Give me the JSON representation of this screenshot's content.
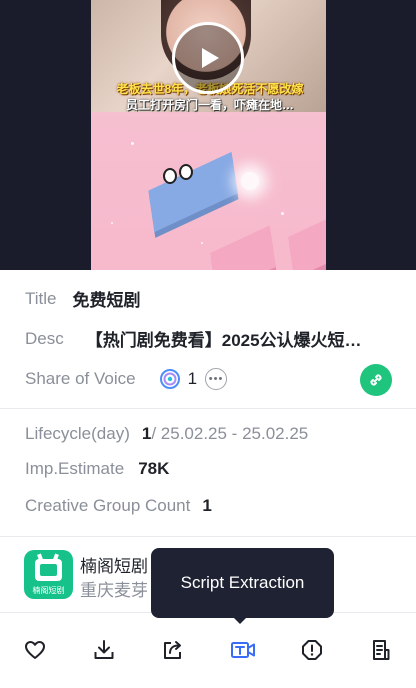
{
  "video": {
    "caption_line1": "老板去世8年，老板娘死活不愿改嫁",
    "caption_line2": "员工打开房门一看，吓瘫在地…",
    "play_icon": "play-icon"
  },
  "info": {
    "title_label": "Title",
    "title_value": "免费短剧",
    "desc_label": "Desc",
    "desc_value": "【热门剧免费看】2025公认爆火短…",
    "sov_label": "Share of Voice",
    "sov_value": "1",
    "more_icon": "more-icon",
    "link_icon": "link-icon"
  },
  "stats": {
    "lifecycle_label": "Lifecycle(day)",
    "lifecycle_value": "1",
    "lifecycle_range": " / 25.02.25 - 25.02.25",
    "imp_label": "Imp.Estimate",
    "imp_value": "78K",
    "cgc_label": "Creative Group Count",
    "cgc_value": "1"
  },
  "advertiser": {
    "app_name": "楠阁短剧",
    "company": "重庆麦芽",
    "logo_text": "楠阁短剧"
  },
  "tooltip": {
    "text": "Script Extraction"
  },
  "toolbar": {
    "icons": [
      "heart-icon",
      "download-icon",
      "share-icon",
      "script-extraction-icon",
      "report-icon",
      "details-icon"
    ],
    "accent": "#3b6cf6",
    "default": "#1f2329"
  },
  "colors": {
    "brand_green": "#1fc47d",
    "tooltip_bg": "#1f2232"
  }
}
